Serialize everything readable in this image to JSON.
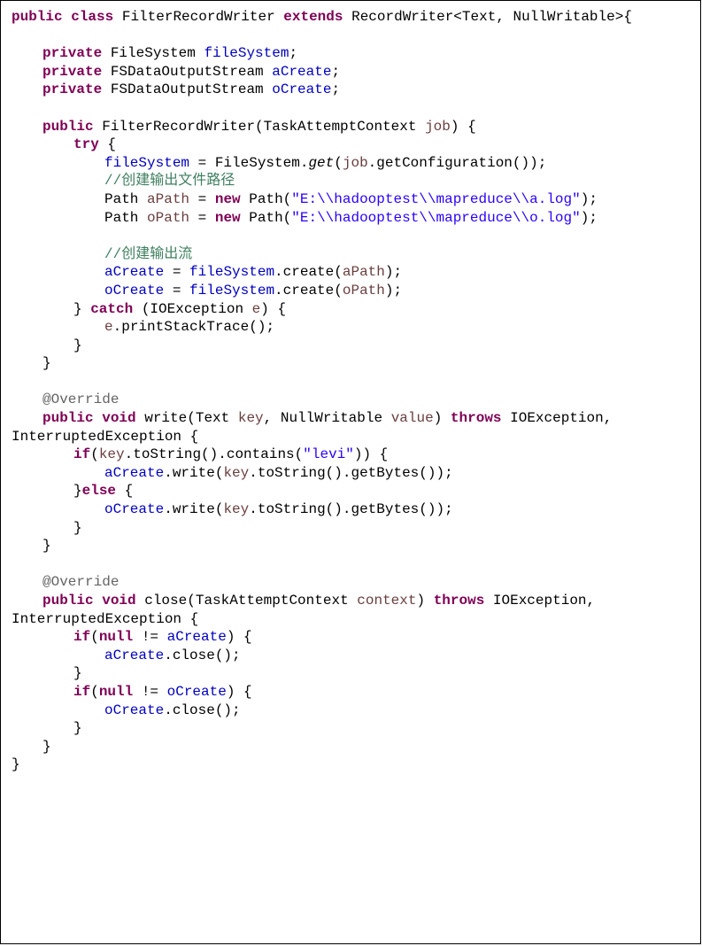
{
  "code": {
    "lines": [
      {
        "tokens": [
          {
            "text": "public",
            "color": "#7F0055",
            "bold": true
          },
          {
            "text": " "
          },
          {
            "text": "class",
            "color": "#7F0055",
            "bold": true
          },
          {
            "text": " FilterRecordWriter "
          },
          {
            "text": "extends",
            "color": "#7F0055",
            "bold": true
          },
          {
            "text": " RecordWriter<Text, NullWritable>{"
          }
        ]
      },
      {
        "tokens": []
      },
      {
        "indent": "\t",
        "tokens": [
          {
            "text": "private",
            "color": "#7F0055",
            "bold": true
          },
          {
            "text": " FileSystem "
          },
          {
            "text": "fileSystem",
            "color": "#0000C0"
          },
          {
            "text": ";"
          }
        ]
      },
      {
        "indent": "\t",
        "tokens": [
          {
            "text": "private",
            "color": "#7F0055",
            "bold": true
          },
          {
            "text": " FSDataOutputStream "
          },
          {
            "text": "aCreate",
            "color": "#0000C0"
          },
          {
            "text": ";"
          }
        ]
      },
      {
        "indent": "\t",
        "tokens": [
          {
            "text": "private",
            "color": "#7F0055",
            "bold": true
          },
          {
            "text": " FSDataOutputStream "
          },
          {
            "text": "oCreate",
            "color": "#0000C0"
          },
          {
            "text": ";"
          }
        ]
      },
      {
        "tokens": []
      },
      {
        "indent": "\t",
        "tokens": [
          {
            "text": "public",
            "color": "#7F0055",
            "bold": true
          },
          {
            "text": " FilterRecordWriter(TaskAttemptContext "
          },
          {
            "text": "job",
            "color": "#6A3E3E"
          },
          {
            "text": ") {"
          }
        ]
      },
      {
        "indent": "\t\t",
        "tokens": [
          {
            "text": "try",
            "color": "#7F0055",
            "bold": true
          },
          {
            "text": " {"
          }
        ]
      },
      {
        "indent": "\t\t\t",
        "tokens": [
          {
            "text": "fileSystem",
            "color": "#0000C0"
          },
          {
            "text": " = FileSystem."
          },
          {
            "text": "get",
            "italic": true
          },
          {
            "text": "("
          },
          {
            "text": "job",
            "color": "#6A3E3E"
          },
          {
            "text": ".getConfiguration());"
          }
        ]
      },
      {
        "indent": "\t\t\t",
        "tokens": [
          {
            "text": "//创建输出文件路径",
            "color": "#3F7F5F"
          }
        ]
      },
      {
        "indent": "\t\t\t",
        "tokens": [
          {
            "text": "Path "
          },
          {
            "text": "aPath",
            "color": "#6A3E3E"
          },
          {
            "text": " = "
          },
          {
            "text": "new",
            "color": "#7F0055",
            "bold": true
          },
          {
            "text": " Path("
          },
          {
            "text": "\"E:\\\\hadooptest\\\\mapreduce\\\\a.log\"",
            "color": "#2A00FF"
          },
          {
            "text": ");"
          }
        ]
      },
      {
        "indent": "\t\t\t",
        "tokens": [
          {
            "text": "Path "
          },
          {
            "text": "oPath",
            "color": "#6A3E3E"
          },
          {
            "text": " = "
          },
          {
            "text": "new",
            "color": "#7F0055",
            "bold": true
          },
          {
            "text": " Path("
          },
          {
            "text": "\"E:\\\\hadooptest\\\\mapreduce\\\\o.log\"",
            "color": "#2A00FF"
          },
          {
            "text": ");"
          }
        ]
      },
      {
        "tokens": []
      },
      {
        "indent": "\t\t\t",
        "tokens": [
          {
            "text": "//创建输出流",
            "color": "#3F7F5F"
          }
        ]
      },
      {
        "indent": "\t\t\t",
        "tokens": [
          {
            "text": "aCreate",
            "color": "#0000C0"
          },
          {
            "text": " = "
          },
          {
            "text": "fileSystem",
            "color": "#0000C0"
          },
          {
            "text": ".create("
          },
          {
            "text": "aPath",
            "color": "#6A3E3E"
          },
          {
            "text": ");"
          }
        ]
      },
      {
        "indent": "\t\t\t",
        "tokens": [
          {
            "text": "oCreate",
            "color": "#0000C0"
          },
          {
            "text": " = "
          },
          {
            "text": "fileSystem",
            "color": "#0000C0"
          },
          {
            "text": ".create("
          },
          {
            "text": "oPath",
            "color": "#6A3E3E"
          },
          {
            "text": ");"
          }
        ]
      },
      {
        "indent": "\t\t",
        "tokens": [
          {
            "text": "} "
          },
          {
            "text": "catch",
            "color": "#7F0055",
            "bold": true
          },
          {
            "text": " (IOException "
          },
          {
            "text": "e",
            "color": "#6A3E3E"
          },
          {
            "text": ") {"
          }
        ]
      },
      {
        "indent": "\t\t\t",
        "tokens": [
          {
            "text": "e",
            "color": "#6A3E3E"
          },
          {
            "text": ".printStackTrace();"
          }
        ]
      },
      {
        "indent": "\t\t",
        "tokens": [
          {
            "text": "}"
          }
        ]
      },
      {
        "indent": "\t",
        "tokens": [
          {
            "text": "}"
          }
        ]
      },
      {
        "tokens": []
      },
      {
        "indent": "\t",
        "tokens": [
          {
            "text": "@Override",
            "color": "#646464"
          }
        ]
      },
      {
        "indent": "\t",
        "tokens": [
          {
            "text": "public",
            "color": "#7F0055",
            "bold": true
          },
          {
            "text": " "
          },
          {
            "text": "void",
            "color": "#7F0055",
            "bold": true
          },
          {
            "text": " write(Text "
          },
          {
            "text": "key",
            "color": "#6A3E3E"
          },
          {
            "text": ", NullWritable "
          },
          {
            "text": "value",
            "color": "#6A3E3E"
          },
          {
            "text": ") "
          },
          {
            "text": "throws",
            "color": "#7F0055",
            "bold": true
          },
          {
            "text": " IOException,"
          }
        ]
      },
      {
        "tokens": [
          {
            "text": "InterruptedException {"
          }
        ]
      },
      {
        "indent": "\t\t",
        "tokens": [
          {
            "text": "if",
            "color": "#7F0055",
            "bold": true
          },
          {
            "text": "("
          },
          {
            "text": "key",
            "color": "#6A3E3E"
          },
          {
            "text": ".toString().contains("
          },
          {
            "text": "\"levi\"",
            "color": "#2A00FF"
          },
          {
            "text": ")) {"
          }
        ]
      },
      {
        "indent": "\t\t\t",
        "tokens": [
          {
            "text": "aCreate",
            "color": "#0000C0"
          },
          {
            "text": ".write("
          },
          {
            "text": "key",
            "color": "#6A3E3E"
          },
          {
            "text": ".toString().getBytes());"
          }
        ]
      },
      {
        "indent": "\t\t",
        "tokens": [
          {
            "text": "}"
          },
          {
            "text": "else",
            "color": "#7F0055",
            "bold": true
          },
          {
            "text": " {"
          }
        ]
      },
      {
        "indent": "\t\t\t",
        "tokens": [
          {
            "text": "oCreate",
            "color": "#0000C0"
          },
          {
            "text": ".write("
          },
          {
            "text": "key",
            "color": "#6A3E3E"
          },
          {
            "text": ".toString().getBytes());"
          }
        ]
      },
      {
        "indent": "\t\t",
        "tokens": [
          {
            "text": "}"
          }
        ]
      },
      {
        "indent": "\t",
        "tokens": [
          {
            "text": "}"
          }
        ]
      },
      {
        "tokens": []
      },
      {
        "indent": "\t",
        "tokens": [
          {
            "text": "@Override",
            "color": "#646464"
          }
        ]
      },
      {
        "indent": "\t",
        "tokens": [
          {
            "text": "public",
            "color": "#7F0055",
            "bold": true
          },
          {
            "text": " "
          },
          {
            "text": "void",
            "color": "#7F0055",
            "bold": true
          },
          {
            "text": " close(TaskAttemptContext "
          },
          {
            "text": "context",
            "color": "#6A3E3E"
          },
          {
            "text": ") "
          },
          {
            "text": "throws",
            "color": "#7F0055",
            "bold": true
          },
          {
            "text": " IOException,"
          }
        ]
      },
      {
        "tokens": [
          {
            "text": "InterruptedException {"
          }
        ]
      },
      {
        "indent": "\t\t",
        "tokens": [
          {
            "text": "if",
            "color": "#7F0055",
            "bold": true
          },
          {
            "text": "("
          },
          {
            "text": "null",
            "color": "#7F0055",
            "bold": true
          },
          {
            "text": " != "
          },
          {
            "text": "aCreate",
            "color": "#0000C0"
          },
          {
            "text": ") {"
          }
        ]
      },
      {
        "indent": "\t\t\t",
        "tokens": [
          {
            "text": "aCreate",
            "color": "#0000C0"
          },
          {
            "text": ".close();"
          }
        ]
      },
      {
        "indent": "\t\t",
        "tokens": [
          {
            "text": "}"
          }
        ]
      },
      {
        "indent": "\t\t",
        "tokens": [
          {
            "text": "if",
            "color": "#7F0055",
            "bold": true
          },
          {
            "text": "("
          },
          {
            "text": "null",
            "color": "#7F0055",
            "bold": true
          },
          {
            "text": " != "
          },
          {
            "text": "oCreate",
            "color": "#0000C0"
          },
          {
            "text": ") {"
          }
        ]
      },
      {
        "indent": "\t\t\t",
        "tokens": [
          {
            "text": "oCreate",
            "color": "#0000C0"
          },
          {
            "text": ".close();"
          }
        ]
      },
      {
        "indent": "\t\t",
        "tokens": [
          {
            "text": "}"
          }
        ]
      },
      {
        "indent": "\t",
        "tokens": [
          {
            "text": "}"
          }
        ]
      },
      {
        "tokens": [
          {
            "text": "}"
          }
        ]
      }
    ]
  }
}
